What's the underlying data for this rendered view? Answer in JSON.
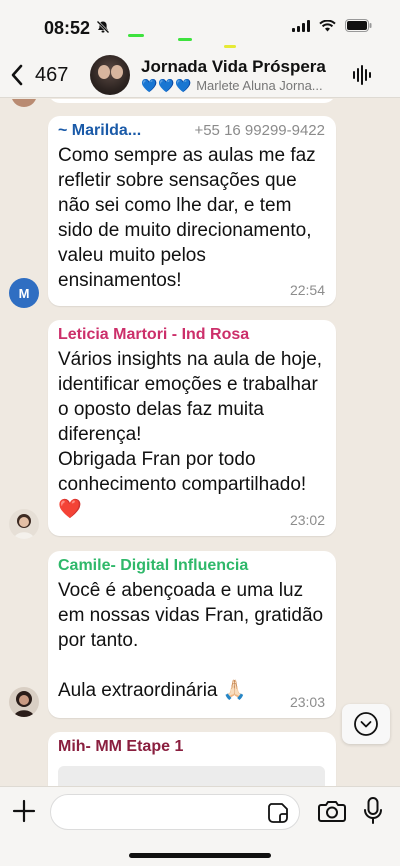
{
  "status_bar": {
    "time": "08:52"
  },
  "header": {
    "back_count": "467",
    "title": "Jornada Vida Próspera",
    "subtitle_hearts": "💙💙💙",
    "subtitle_text": "Marlete Aluna Jorna..."
  },
  "messages": [
    {
      "sender": "~ Marilda...",
      "sender_color": "#1a5aa8",
      "phone": "+55 16 99299-9422",
      "text": "Como sempre as aulas me faz refletir sobre sensações que não sei como lhe dar, e tem sido de muito direcionamento, valeu muito pelos ensinamentos!",
      "time": "22:54",
      "avatar_letter": "M"
    },
    {
      "sender": "Leticia Martori - Ind Rosa",
      "sender_color": "#cc2f6a",
      "text": "Vários insights na aula de hoje, identificar emoções e trabalhar o oposto delas faz muita diferença!\nObrigada Fran por todo conhecimento compartilhado! ❤️",
      "time": "23:02"
    },
    {
      "sender": "Camile- Digital Influencia",
      "sender_color": "#2fb86a",
      "text": "Você é abençoada e uma luz em nossas vidas Fran, gratidão por tanto.\n\nAula extraordinária 🙏🏻",
      "time": "23:03"
    },
    {
      "sender": "Mih- MM Etape 1",
      "sender_color": "#8a1f3f"
    }
  ],
  "icons": [
    "chevron-left-icon",
    "bell-off-icon",
    "signal-icon",
    "wifi-icon",
    "battery-icon",
    "audio-wave-icon",
    "chevron-down-icon",
    "plus-icon",
    "sticker-icon",
    "camera-icon",
    "mic-icon"
  ]
}
